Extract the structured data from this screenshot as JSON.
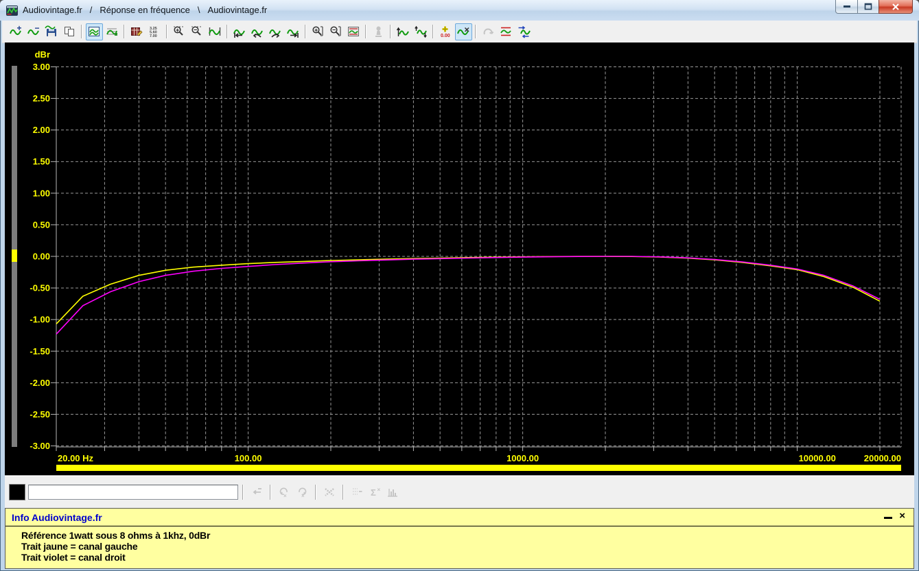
{
  "window": {
    "title_parts": [
      "Audiovintage.fr",
      "/",
      "Réponse en fréquence",
      "\\",
      "Audiovintage.fr"
    ]
  },
  "toolbar": {
    "items": [
      {
        "name": "add-trace-icon"
      },
      {
        "name": "remove-trace-icon"
      },
      {
        "name": "save-trace-icon"
      },
      {
        "name": "copy-icon"
      },
      {
        "sep": true
      },
      {
        "name": "show-traces-icon",
        "state": "active"
      },
      {
        "name": "traces-grid-icon"
      },
      {
        "sep": true
      },
      {
        "name": "edit-table-icon"
      },
      {
        "name": "values-icon"
      },
      {
        "sep": true
      },
      {
        "name": "zoom-in-x-icon"
      },
      {
        "name": "zoom-out-x-icon"
      },
      {
        "name": "trace-range-icon"
      },
      {
        "sep": true
      },
      {
        "name": "pan-first-icon"
      },
      {
        "name": "pan-left-icon"
      },
      {
        "name": "pan-right-icon"
      },
      {
        "name": "pan-last-icon"
      },
      {
        "sep": true
      },
      {
        "name": "zoom-in-y-icon"
      },
      {
        "name": "zoom-out-y-icon"
      },
      {
        "name": "fit-trace-icon"
      },
      {
        "sep": true
      },
      {
        "name": "protect-icon",
        "state": "disabled"
      },
      {
        "sep": true
      },
      {
        "name": "wave-up-icon"
      },
      {
        "name": "wave-updown-icon"
      },
      {
        "sep": true
      },
      {
        "name": "offset-zero-icon"
      },
      {
        "name": "cursor-icon",
        "state": "active"
      },
      {
        "sep": true
      },
      {
        "name": "redo-icon",
        "state": "disabled"
      },
      {
        "name": "limits-icon"
      },
      {
        "name": "shift-trace-icon"
      }
    ]
  },
  "chart_data": {
    "type": "line",
    "title": "",
    "ylabel": "dBr",
    "xlabel": "",
    "x_scale": "log",
    "xlim": [
      20,
      20000
    ],
    "ylim": [
      -3,
      3
    ],
    "grid": true,
    "colors": {
      "background": "#000000",
      "grid": "#9a9a9a",
      "axis": "#b8b8b8",
      "labels": "#ffff00",
      "meter_bar": "#7d7d7d",
      "meter_marker": "#ffff00",
      "sweep_bar": "#ffff00"
    },
    "y_tick_labels": [
      "3.00",
      "2.50",
      "2.00",
      "1.50",
      "1.00",
      "0.50",
      "0.00",
      "-0.50",
      "-1.00",
      "-1.50",
      "-2.00",
      "-2.50",
      "-3.00"
    ],
    "x_gridlines": [
      20,
      30,
      40,
      50,
      60,
      70,
      80,
      90,
      100,
      200,
      300,
      400,
      500,
      600,
      700,
      800,
      900,
      1000,
      2000,
      3000,
      4000,
      5000,
      6000,
      7000,
      8000,
      9000,
      10000,
      20000
    ],
    "x_tick_labels": [
      {
        "f": 20,
        "label": "20.00 Hz"
      },
      {
        "f": 100,
        "label": "100.00"
      },
      {
        "f": 1000,
        "label": "1000.00"
      },
      {
        "f": 10000,
        "label": "10000.00"
      },
      {
        "f": 20000,
        "label": "20000.00"
      }
    ],
    "series": [
      {
        "name": "canal gauche (trait jaune)",
        "color": "#ffff00",
        "points": [
          [
            20,
            -1.07
          ],
          [
            25,
            -0.63
          ],
          [
            31.5,
            -0.44
          ],
          [
            40,
            -0.3
          ],
          [
            50,
            -0.22
          ],
          [
            63,
            -0.17
          ],
          [
            80,
            -0.14
          ],
          [
            100,
            -0.115
          ],
          [
            125,
            -0.095
          ],
          [
            160,
            -0.08
          ],
          [
            200,
            -0.065
          ],
          [
            250,
            -0.055
          ],
          [
            315,
            -0.045
          ],
          [
            400,
            -0.035
          ],
          [
            500,
            -0.028
          ],
          [
            630,
            -0.02
          ],
          [
            800,
            -0.013
          ],
          [
            1000,
            -0.008
          ],
          [
            1250,
            -0.003
          ],
          [
            1600,
            0
          ],
          [
            2000,
            0
          ],
          [
            2500,
            -0.002
          ],
          [
            3150,
            -0.01
          ],
          [
            4000,
            -0.028
          ],
          [
            5000,
            -0.055
          ],
          [
            6300,
            -0.095
          ],
          [
            8000,
            -0.15
          ],
          [
            10000,
            -0.21
          ],
          [
            12500,
            -0.32
          ],
          [
            16000,
            -0.49
          ],
          [
            20000,
            -0.71
          ]
        ]
      },
      {
        "name": "canal droit (trait violet)",
        "color": "#ff00ff",
        "points": [
          [
            20,
            -1.23
          ],
          [
            25,
            -0.78
          ],
          [
            31.5,
            -0.56
          ],
          [
            40,
            -0.4
          ],
          [
            50,
            -0.3
          ],
          [
            63,
            -0.235
          ],
          [
            80,
            -0.19
          ],
          [
            100,
            -0.16
          ],
          [
            125,
            -0.13
          ],
          [
            160,
            -0.105
          ],
          [
            200,
            -0.085
          ],
          [
            250,
            -0.07
          ],
          [
            315,
            -0.057
          ],
          [
            400,
            -0.045
          ],
          [
            500,
            -0.036
          ],
          [
            630,
            -0.027
          ],
          [
            800,
            -0.018
          ],
          [
            1000,
            -0.012
          ],
          [
            1250,
            -0.006
          ],
          [
            1600,
            -0.002
          ],
          [
            2000,
            0
          ],
          [
            2500,
            0
          ],
          [
            3150,
            -0.008
          ],
          [
            4000,
            -0.024
          ],
          [
            5000,
            -0.05
          ],
          [
            6300,
            -0.088
          ],
          [
            8000,
            -0.14
          ],
          [
            10000,
            -0.2
          ],
          [
            12500,
            -0.3
          ],
          [
            16000,
            -0.47
          ],
          [
            20000,
            -0.68
          ]
        ]
      }
    ]
  },
  "bottom_toolbar": {
    "input_value": "",
    "input_placeholder": "",
    "items": [
      {
        "name": "cursor-apply-icon",
        "state": "disabled"
      },
      {
        "sep": true
      },
      {
        "name": "loop-left-icon",
        "state": "disabled"
      },
      {
        "name": "loop-right-icon",
        "state": "disabled"
      },
      {
        "sep": true
      },
      {
        "name": "delete-x-icon",
        "state": "disabled"
      },
      {
        "sep": true
      },
      {
        "name": "list-minus-icon",
        "state": "disabled"
      },
      {
        "name": "sigma-icon",
        "state": "disabled"
      },
      {
        "name": "histogram-icon",
        "state": "disabled"
      }
    ]
  },
  "info_panel": {
    "title": "Info Audiovintage.fr",
    "lines": [
      "Référence 1watt sous 8 ohms à 1khz, 0dBr",
      "Trait jaune = canal gauche",
      "Trait violet = canal droit"
    ]
  }
}
